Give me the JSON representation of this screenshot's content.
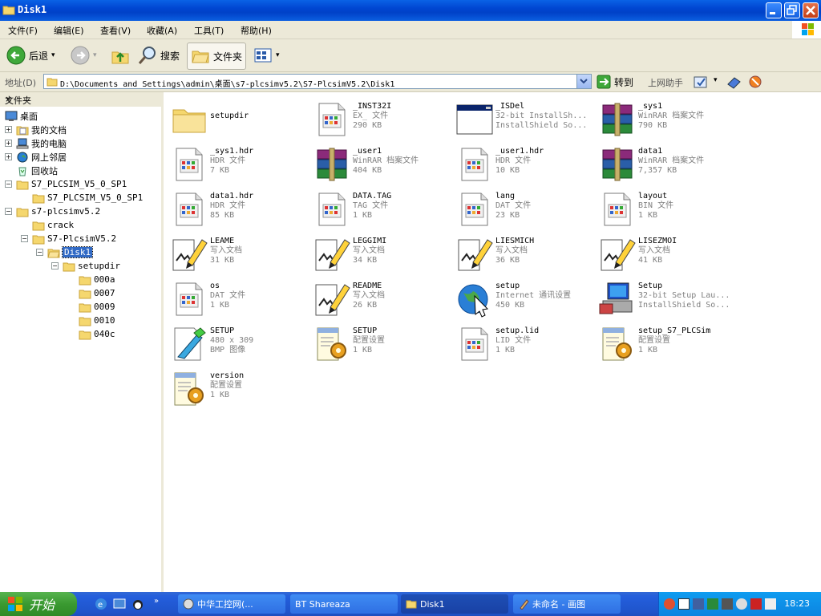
{
  "window": {
    "title": "Disk1"
  },
  "menu": [
    "文件(F)",
    "编辑(E)",
    "查看(V)",
    "收藏(A)",
    "工具(T)",
    "帮助(H)"
  ],
  "toolbar": {
    "back": "后退",
    "search": "搜索",
    "folders": "文件夹"
  },
  "address": {
    "label": "地址(D)",
    "path": "D:\\Documents and Settings\\admin\\桌面\\s7-plcsimv5.2\\S7-PlcsimV5.2\\Disk1",
    "go": "转到",
    "helper": "上网助手"
  },
  "folder_pane": {
    "title": "文件夹",
    "close": "×",
    "tree": [
      {
        "label": "桌面"
      },
      {
        "label": "我的文档"
      },
      {
        "label": "我的电脑"
      },
      {
        "label": "网上邻居"
      },
      {
        "label": "回收站"
      },
      {
        "label": "S7_PLCSIM_V5_0_SP1"
      },
      {
        "label": "S7_PLCSIM_V5_0_SP1"
      },
      {
        "label": "s7-plcsimv5.2"
      },
      {
        "label": "crack"
      },
      {
        "label": "S7-PlcsimV5.2"
      },
      {
        "label": "Disk1"
      },
      {
        "label": "setupdir"
      },
      {
        "label": "000a"
      },
      {
        "label": "0007"
      },
      {
        "label": "0009"
      },
      {
        "label": "0010"
      },
      {
        "label": "040c"
      }
    ]
  },
  "files": [
    {
      "name": "setupdir",
      "type": "",
      "size": "",
      "icon": "folder-icon"
    },
    {
      "name": "_INST32I",
      "type": "EX_ 文件",
      "size": "290 KB",
      "icon": "generic-file-icon"
    },
    {
      "name": "_ISDel",
      "type": "32-bit InstallSh...",
      "size": "InstallShield So...",
      "icon": "app-window-icon"
    },
    {
      "name": "_sys1",
      "type": "WinRAR 档案文件",
      "size": "790 KB",
      "icon": "winrar-icon"
    },
    {
      "name": "_sys1.hdr",
      "type": "HDR 文件",
      "size": "7 KB",
      "icon": "generic-file-icon"
    },
    {
      "name": "_user1",
      "type": "WinRAR 档案文件",
      "size": "404 KB",
      "icon": "winrar-icon"
    },
    {
      "name": "_user1.hdr",
      "type": "HDR 文件",
      "size": "10 KB",
      "icon": "generic-file-icon"
    },
    {
      "name": "data1",
      "type": "WinRAR 档案文件",
      "size": "7,357 KB",
      "icon": "winrar-icon"
    },
    {
      "name": "data1.hdr",
      "type": "HDR 文件",
      "size": "85 KB",
      "icon": "generic-file-icon"
    },
    {
      "name": "DATA.TAG",
      "type": "TAG 文件",
      "size": "1 KB",
      "icon": "generic-file-icon"
    },
    {
      "name": "lang",
      "type": "DAT 文件",
      "size": "23 KB",
      "icon": "generic-file-icon"
    },
    {
      "name": "layout",
      "type": "BIN 文件",
      "size": "1 KB",
      "icon": "generic-file-icon"
    },
    {
      "name": "LEAME",
      "type": "写入文档",
      "size": "31 KB",
      "icon": "write-doc-icon"
    },
    {
      "name": "LEGGIMI",
      "type": "写入文档",
      "size": "34 KB",
      "icon": "write-doc-icon"
    },
    {
      "name": "LIESMICH",
      "type": "写入文档",
      "size": "36 KB",
      "icon": "write-doc-icon"
    },
    {
      "name": "LISEZMOI",
      "type": "写入文档",
      "size": "41 KB",
      "icon": "write-doc-icon"
    },
    {
      "name": "os",
      "type": "DAT 文件",
      "size": "1 KB",
      "icon": "generic-file-icon"
    },
    {
      "name": "README",
      "type": "写入文档",
      "size": "26 KB",
      "icon": "write-doc-icon"
    },
    {
      "name": "setup",
      "type": "Internet 通讯设置",
      "size": "450 KB",
      "icon": "internet-settings-icon"
    },
    {
      "name": "Setup",
      "type": "32-bit Setup Lau...",
      "size": "InstallShield So...",
      "icon": "setup-computer-icon"
    },
    {
      "name": "SETUP",
      "type": "480 x 309",
      "size": "BMP 图像",
      "icon": "bitmap-icon"
    },
    {
      "name": "SETUP",
      "type": "配置设置",
      "size": "1 KB",
      "icon": "config-gear-icon"
    },
    {
      "name": "setup.lid",
      "type": "LID 文件",
      "size": "1 KB",
      "icon": "generic-file-icon"
    },
    {
      "name": "setup_S7_PLCSim",
      "type": "配置设置",
      "size": "1 KB",
      "icon": "config-gear-icon"
    },
    {
      "name": "version",
      "type": "配置设置",
      "size": "1 KB",
      "icon": "config-gear-icon"
    }
  ],
  "taskbar": {
    "start": "开始",
    "tasks": [
      {
        "label": "中华工控网(..."
      },
      {
        "label": "BT Shareaza"
      },
      {
        "label": "Disk1"
      },
      {
        "label": "未命名 - 画图"
      }
    ],
    "clock": "18:23"
  },
  "colors": {
    "titlebar": "#0046d1",
    "selection": "#316ac5",
    "chrome": "#ece9d8",
    "start": "#3a9a31"
  }
}
